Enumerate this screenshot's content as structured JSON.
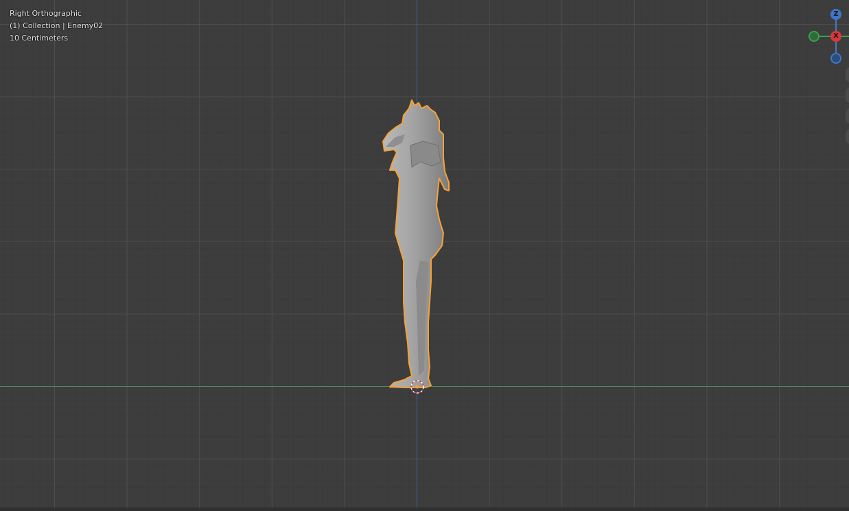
{
  "viewport": {
    "view_name": "Right Orthographic",
    "collection_info": "(1) Collection | Enemy02",
    "grid_scale": "10 Centimeters"
  },
  "gizmo": {
    "z_label": "Z",
    "x_label": "X",
    "z_color": "#3e76c9",
    "x_color": "#d5383c",
    "y_color": "#3f9f4d",
    "neg_z_color": "#2b5a96"
  },
  "colors": {
    "background": "#3d3d3d",
    "selection_outline": "#f4a23a",
    "mesh": "#9a9a9a"
  }
}
